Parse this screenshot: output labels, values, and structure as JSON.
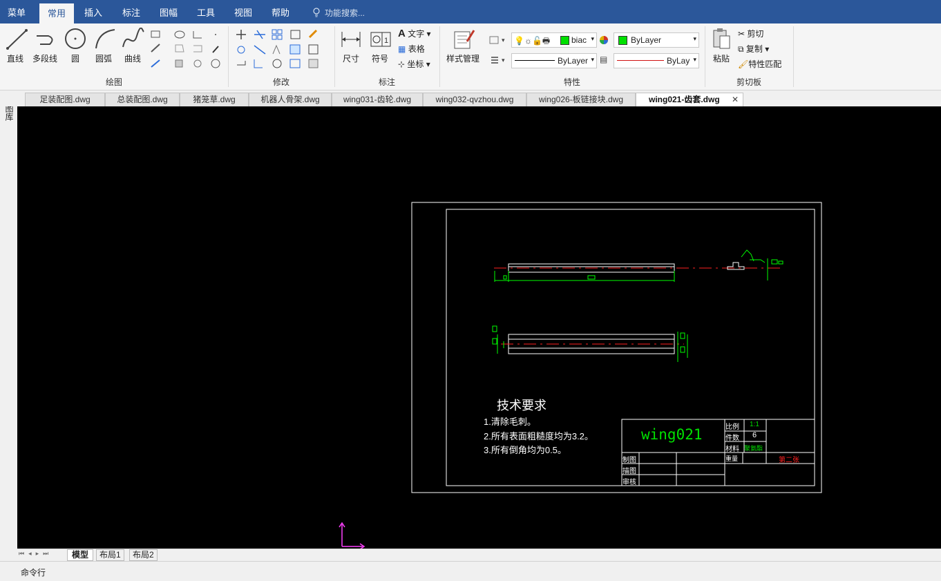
{
  "menubar": {
    "items": [
      "菜单",
      "常用",
      "插入",
      "标注",
      "图幅",
      "工具",
      "视图",
      "帮助"
    ],
    "active": "常用",
    "search_placeholder": "功能搜索..."
  },
  "ribbon": {
    "draw": {
      "label": "绘图",
      "line": "直线",
      "polyline": "多段线",
      "circle": "圆",
      "arc": "圆弧",
      "curve": "曲线"
    },
    "modify": {
      "label": "修改"
    },
    "annotate": {
      "label": "标注",
      "dimension": "尺寸",
      "symbol": "符号",
      "text": "文字",
      "table": "表格",
      "coordinate": "坐标"
    },
    "properties": {
      "label": "特性",
      "style_manager": "样式管理",
      "layer_name": "biac",
      "color_value": "ByLayer",
      "linetype_value": "ByLayer",
      "lineweight_value": "ByLay",
      "color_swatch": "#00e000"
    },
    "clipboard": {
      "label": "剪切板",
      "paste": "粘贴",
      "cut": "剪切",
      "copy": "复制",
      "match": "特性匹配"
    }
  },
  "side_panel": {
    "label": "图库"
  },
  "doc_tabs": [
    "足装配图.dwg",
    "总装配图.dwg",
    "猪笼草.dwg",
    "机器人骨架.dwg",
    "wing031-齿轮.dwg",
    "wing032-qvzhou.dwg",
    "wing026-板链接块.dwg",
    "wing021-齿套.dwg"
  ],
  "active_doc": "wing021-齿套.dwg",
  "drawing": {
    "tech_title": "技术要求",
    "tech_lines": [
      "1.清除毛刺。",
      "2.所有表面粗糙度均为3.2。",
      "3.所有倒角均为0.5。"
    ],
    "titleblock": {
      "name": "wing021",
      "scale_label": "比例",
      "scale_value": "1:1",
      "qty_label": "件数",
      "qty_value": "6",
      "material_label": "材料",
      "material_value": "聚氨酯",
      "weight_label": "重量",
      "sheet_label": "第二张",
      "draw_label": "制图",
      "trace_label": "描图",
      "review_label": "审核"
    }
  },
  "layout_tabs": [
    "模型",
    "布局1",
    "布局2"
  ],
  "command_line": {
    "label": "命令行"
  }
}
